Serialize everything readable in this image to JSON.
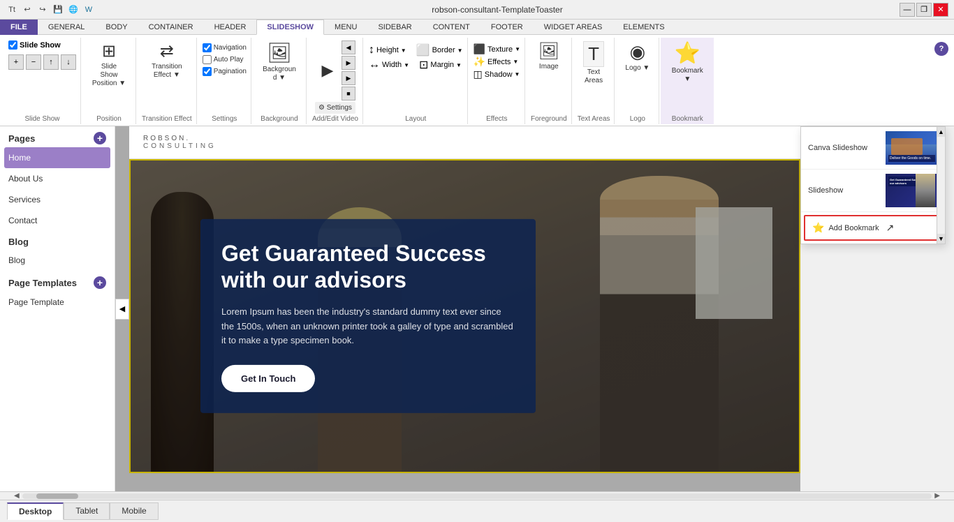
{
  "title_bar": {
    "title": "robson-consultant-TemplateToaster",
    "min_btn": "—",
    "restore_btn": "❐",
    "close_btn": "✕"
  },
  "ribbon": {
    "tabs": [
      {
        "id": "file",
        "label": "FILE",
        "active": false,
        "is_file": true
      },
      {
        "id": "general",
        "label": "GENERAL",
        "active": false
      },
      {
        "id": "body",
        "label": "BODY",
        "active": false
      },
      {
        "id": "container",
        "label": "CONTAINER",
        "active": false
      },
      {
        "id": "header",
        "label": "HEADER",
        "active": false
      },
      {
        "id": "slideshow",
        "label": "SLIDESHOW",
        "active": true
      },
      {
        "id": "menu",
        "label": "MENU",
        "active": false
      },
      {
        "id": "sidebar",
        "label": "SIDEBAR",
        "active": false
      },
      {
        "id": "content",
        "label": "CONTENT",
        "active": false
      },
      {
        "id": "footer",
        "label": "FOOTER",
        "active": false
      },
      {
        "id": "widget_areas",
        "label": "WIDGET AREAS",
        "active": false
      },
      {
        "id": "elements",
        "label": "ELEMENTS",
        "active": false
      }
    ],
    "slideshow_group": {
      "slideshow_check": "Slide Show",
      "add_btn": "+",
      "remove_btn": "−",
      "up_btn": "↑",
      "down_btn": "↓",
      "label": "Slide Show"
    },
    "position_group": {
      "icon": "⊞",
      "label": "Slide Show\nPosition",
      "arrow": "▼"
    },
    "transition_group": {
      "icon": "⇄",
      "label": "Transition\nEffect",
      "arrow": "▼"
    },
    "settings_group": {
      "navigation_label": "Navigation",
      "auto_play_label": "Auto Play",
      "pagination_label": "Pagination",
      "navigation_checked": true,
      "auto_play_checked": false,
      "pagination_checked": true,
      "label": "Settings"
    },
    "background_group": {
      "icon": "🖼",
      "label": "Background",
      "arrow": "▼"
    },
    "add_edit_video_group": {
      "icon": "▶",
      "label": "Add/Edit\nVideo"
    },
    "layout_group": {
      "height_label": "Height",
      "width_label": "Width",
      "border_label": "Border",
      "margin_label": "Margin",
      "label": "Layout"
    },
    "effects_group": {
      "texture_label": "Texture",
      "effects_label": "Effects",
      "shadow_label": "Shadow",
      "label": "Effects"
    },
    "foreground_group": {
      "icon": "🖼",
      "label": "Image",
      "group_label": "Foreground"
    },
    "text_areas_group": {
      "icon": "T",
      "label": "Text\nAreas",
      "group_label": "Text Areas"
    },
    "logo_group": {
      "icon": "◉",
      "label": "Logo",
      "group_label": "Logo"
    },
    "bookmark_group": {
      "icon": "⭐",
      "label": "Bookmark",
      "group_label": "Bookmark"
    }
  },
  "sidebar": {
    "pages_label": "Pages",
    "pages": [
      {
        "label": "Home",
        "active": true
      },
      {
        "label": "About Us",
        "active": false
      },
      {
        "label": "Services",
        "active": false
      },
      {
        "label": "Contact",
        "active": false
      }
    ],
    "blog_label": "Blog",
    "blog_items": [
      {
        "label": "Blog",
        "active": false
      }
    ],
    "page_templates_label": "Page Templates",
    "page_templates": [
      {
        "label": "Page Template",
        "active": false
      }
    ]
  },
  "canvas": {
    "logo_name": "ROBSON.",
    "logo_tagline": "CONSULTING",
    "hero_title": "Get Guaranteed Success with our advisors",
    "hero_desc": "Lorem Ipsum has been the industry's standard dummy text ever since the 1500s, when an unknown printer took a galley of type and scrambled it to make a type specimen book.",
    "hero_btn": "Get In Touch"
  },
  "right_panel": {
    "items": [
      {
        "label": "Canva Slideshow",
        "has_thumb": true
      },
      {
        "label": "Slideshow",
        "has_thumb": true
      }
    ],
    "add_bookmark_label": "Add Bookmark",
    "scroll_up": "▲",
    "scroll_down": "▼"
  },
  "status_bar": {
    "tabs": [
      {
        "label": "Desktop",
        "active": true
      },
      {
        "label": "Tablet",
        "active": false
      },
      {
        "label": "Mobile",
        "active": false
      }
    ],
    "scroll_left": "◀",
    "scroll_right": "▶"
  }
}
